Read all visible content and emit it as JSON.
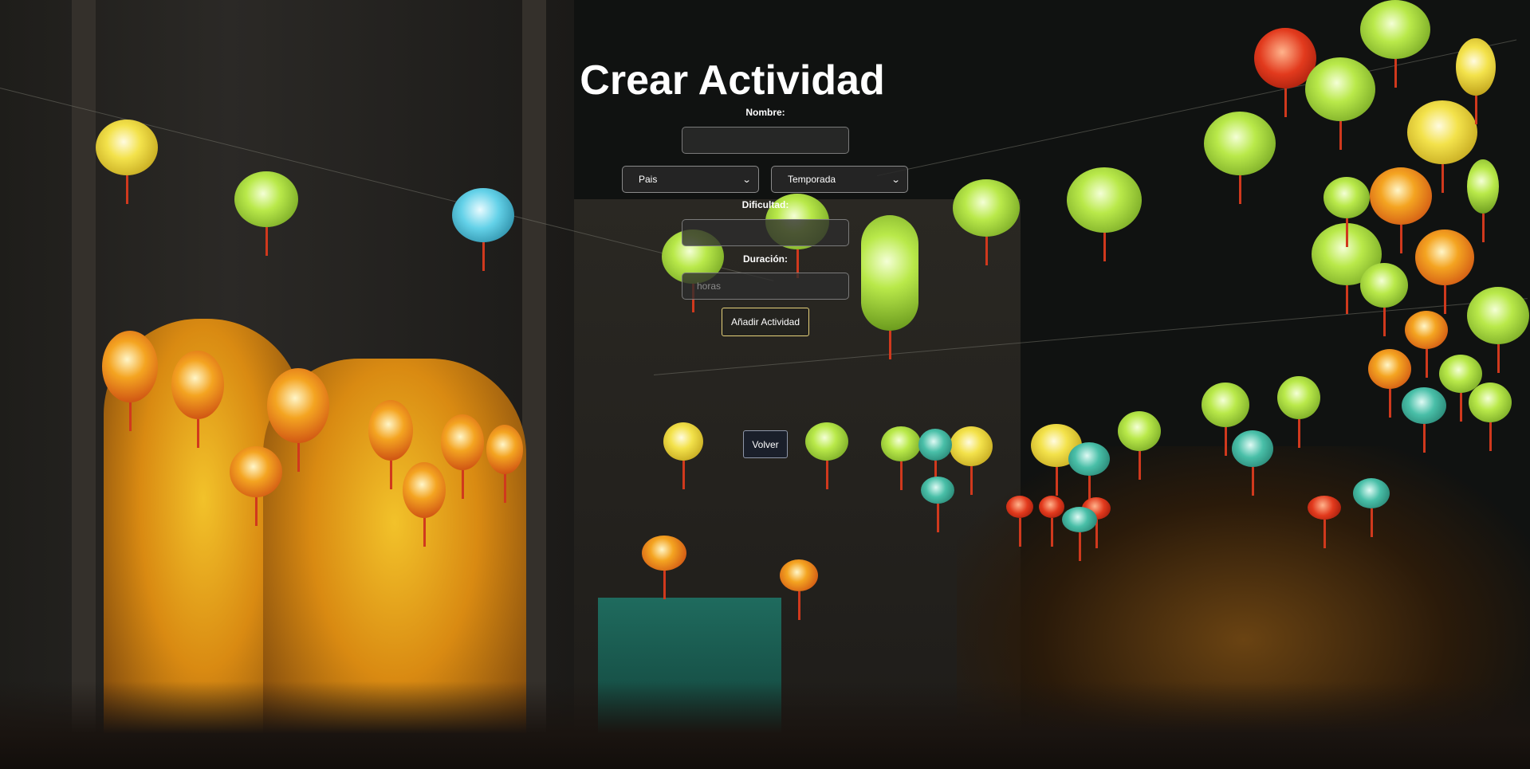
{
  "page": {
    "title": "Crear Actividad"
  },
  "form": {
    "nombre": {
      "label": "Nombre:",
      "value": "",
      "placeholder": ""
    },
    "pais_select": {
      "selected": "Pais"
    },
    "temporada_select": {
      "selected": "Temporada"
    },
    "dificultad": {
      "label": "Dificultad:",
      "value": "",
      "placeholder": ""
    },
    "duracion": {
      "label": "Duración:",
      "value": "",
      "placeholder": "horas"
    },
    "submit_label": "Añadir Actividad"
  },
  "nav": {
    "back_label": "Volver"
  },
  "icons": {
    "select_arrow": "chevron-down-icon"
  },
  "colors": {
    "title": "#ffffff",
    "submit_border": "#e6d27a",
    "back_border": "#8e96a8"
  }
}
